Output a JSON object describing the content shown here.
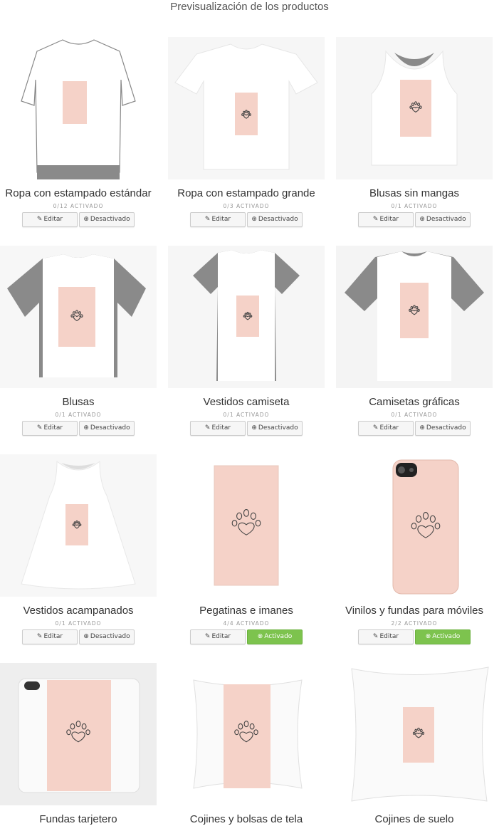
{
  "page_title": "Previsualización de los productos",
  "colors": {
    "pink": "#f5d2c8",
    "grey": "#8a8a8a",
    "active": "#7dc34e"
  },
  "products": [
    {
      "name": "Ropa con estampado estándar",
      "status": "0/12 ACTIVADO",
      "edit": "Editar",
      "toggle": "Desactivado",
      "active": false,
      "icon": "tshirt-outline"
    },
    {
      "name": "Ropa con estampado grande",
      "status": "0/3 ACTIVADO",
      "edit": "Editar",
      "toggle": "Desactivado",
      "active": false,
      "icon": "tshirt"
    },
    {
      "name": "Blusas sin mangas",
      "status": "0/1 ACTIVADO",
      "edit": "Editar",
      "toggle": "Desactivado",
      "active": false,
      "icon": "tank-top"
    },
    {
      "name": "Blusas",
      "status": "0/1 ACTIVADO",
      "edit": "Editar",
      "toggle": "Desactivado",
      "active": false,
      "icon": "blouse"
    },
    {
      "name": "Vestidos camiseta",
      "status": "0/1 ACTIVADO",
      "edit": "Editar",
      "toggle": "Desactivado",
      "active": false,
      "icon": "tshirt-dress"
    },
    {
      "name": "Camisetas gráficas",
      "status": "0/1 ACTIVADO",
      "edit": "Editar",
      "toggle": "Desactivado",
      "active": false,
      "icon": "graphic-tee"
    },
    {
      "name": "Vestidos acampanados",
      "status": "0/1 ACTIVADO",
      "edit": "Editar",
      "toggle": "Desactivado",
      "active": false,
      "icon": "a-line-dress"
    },
    {
      "name": "Pegatinas e imanes",
      "status": "4/4 ACTIVADO",
      "edit": "Editar",
      "toggle": "Activado",
      "active": true,
      "icon": "sticker"
    },
    {
      "name": "Vinilos y fundas para móviles",
      "status": "2/2 ACTIVADO",
      "edit": "Editar",
      "toggle": "Activado",
      "active": true,
      "icon": "phone-case"
    },
    {
      "name": "Fundas tarjetero",
      "status": "",
      "edit": "",
      "toggle": "",
      "active": false,
      "icon": "wallet-case"
    },
    {
      "name": "Cojines y bolsas de tela",
      "status": "",
      "edit": "",
      "toggle": "",
      "active": false,
      "icon": "pillow"
    },
    {
      "name": "Cojines de suelo",
      "status": "",
      "edit": "",
      "toggle": "",
      "active": false,
      "icon": "floor-pillow"
    }
  ]
}
